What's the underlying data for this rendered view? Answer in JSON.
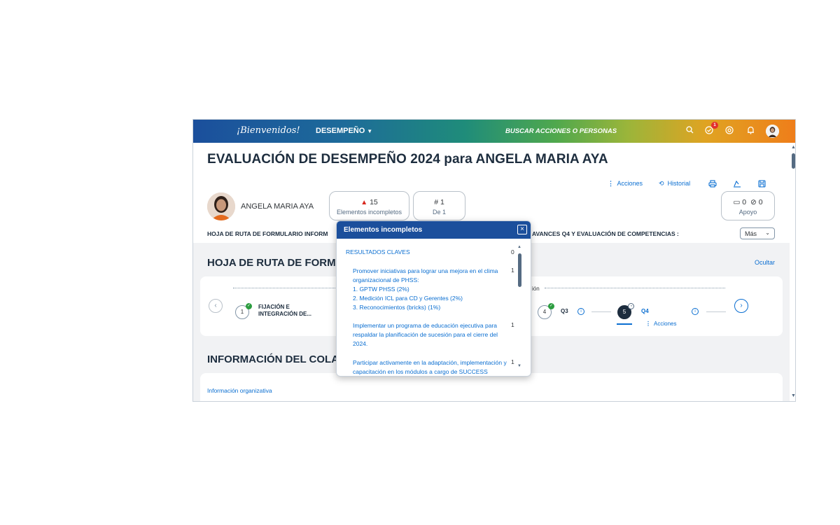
{
  "shell": {
    "logo": "¡Bienvenidos!",
    "module": "DESEMPEÑO",
    "search_placeholder": "BUSCAR ACCIONES O PERSONAS",
    "notification_badge": "1"
  },
  "page": {
    "title": "EVALUACIÓN DE DESEMPEÑO 2024 para ANGELA MARIA AYA"
  },
  "toolbar": {
    "actions": "Acciones",
    "history": "Historial"
  },
  "person": {
    "name": "ANGELA MARIA AYA"
  },
  "stats": {
    "incomplete_value": "15",
    "incomplete_label": "Elementos incompletos",
    "page_value": "1",
    "page_label": "De 1",
    "comments": "0",
    "attachments": "0",
    "support_label": "Apoyo"
  },
  "section_nav": {
    "left": "HOJA DE RUTA DE FORMULARIO   INFORM",
    "right": "AVANCES Q4 Y EVALUACIÓN DE COMPETENCIAS :",
    "more": "Más"
  },
  "sections": {
    "roadmap_title": "HOJA DE RUTA DE FORM",
    "hide": "Ocultar",
    "info_title": "INFORMACIÓN DEL COLA",
    "info_org": "Información organizativa"
  },
  "roadmap": {
    "step1_num": "1",
    "step1_label_a": "FIJACIÓN E",
    "step1_label_b": "INTEGRACIÓN DE...",
    "dotted_label": "ión",
    "step4_num": "4",
    "step4_label": "Q3",
    "step5_num": "5",
    "step5_label": "Q4",
    "actions": "Acciones"
  },
  "popover": {
    "title": "Elementos incompletos",
    "group": "RESULTADOS CLAVES",
    "group_count": "0",
    "items": [
      {
        "text": "Promover iniciativas para lograr una mejora en el clima organizacional de PHSS:",
        "count": "1"
      },
      {
        "text": "Implementar un programa de educación ejecutiva para respaldar la planificación de sucesión para el cierre del 2024.",
        "count": "1"
      },
      {
        "text": "Participar activamente en la adaptación, implementación y capacitación en los módulos a cargo de SUCCESS",
        "count": "1"
      }
    ],
    "sub_items": [
      "1. GPTW PHSS (2%)",
      "2. Medición ICL para CD y Gerentes (2%)",
      "3. Reconocimientos (bricks) (1%)"
    ]
  }
}
